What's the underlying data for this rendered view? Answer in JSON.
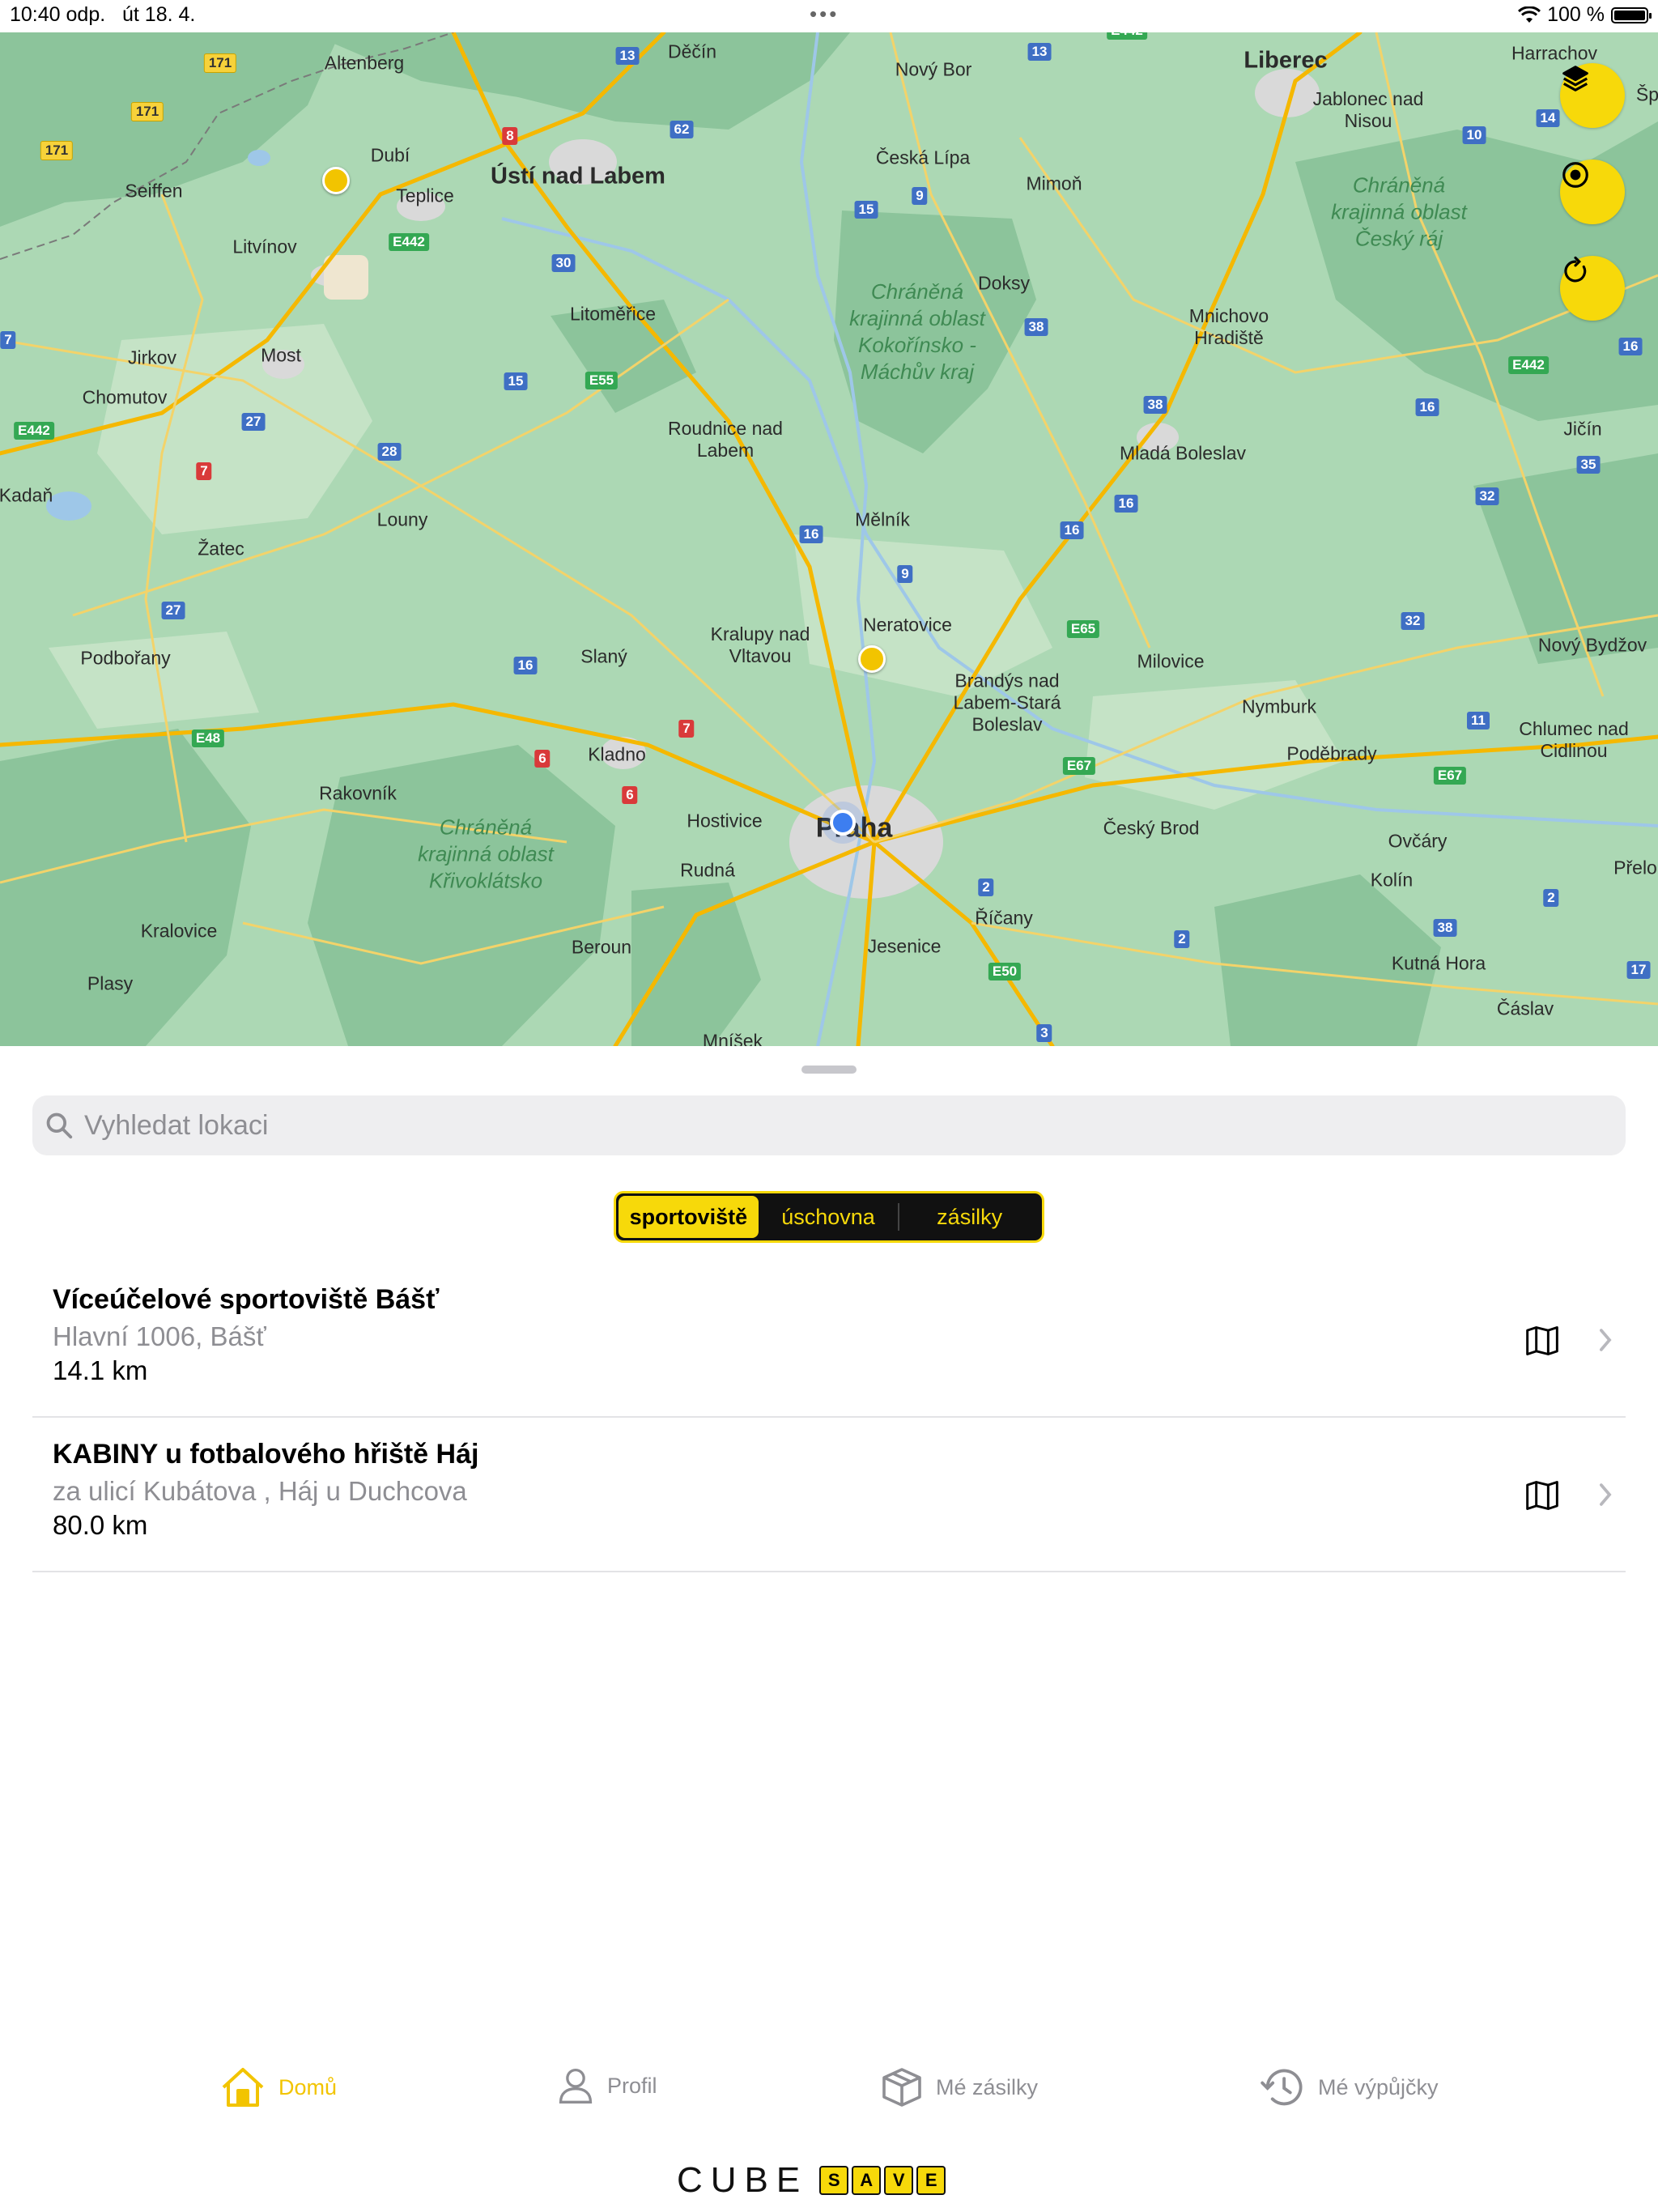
{
  "status_bar": {
    "time": "10:40 odp.",
    "date": "út 18. 4.",
    "battery_label": "100 %",
    "battery_level": 1.0
  },
  "map": {
    "labels": [
      {
        "text": "Altenberg",
        "size": "n"
      },
      {
        "text": "Děčín",
        "size": "n"
      },
      {
        "text": "Nový Bor",
        "size": "n"
      },
      {
        "text": "Liberec",
        "size": "big"
      },
      {
        "text": "Harrachov",
        "size": "n"
      },
      {
        "text": "Jablonec nad Nisou",
        "size": "n"
      },
      {
        "text": "Dubí",
        "size": "n"
      },
      {
        "text": "Ústí nad Labem",
        "size": "big"
      },
      {
        "text": "Teplice",
        "size": "n"
      },
      {
        "text": "Seiffen",
        "size": "n"
      },
      {
        "text": "Česká Lípa",
        "size": "n"
      },
      {
        "text": "Mimoň",
        "size": "n"
      },
      {
        "text": "Litvínov",
        "size": "n"
      },
      {
        "text": "Doksy",
        "size": "n"
      },
      {
        "text": "Litoměřice",
        "size": "n"
      },
      {
        "text": "Mnichovo Hradiště",
        "size": "n"
      },
      {
        "text": "Jirkov",
        "size": "n"
      },
      {
        "text": "Most",
        "size": "n"
      },
      {
        "text": "Chomutov",
        "size": "n"
      },
      {
        "text": "Roudnice nad Labem",
        "size": "n"
      },
      {
        "text": "Mladá Boleslav",
        "size": "n"
      },
      {
        "text": "Jičín",
        "size": "n"
      },
      {
        "text": "Kadaň",
        "size": "n"
      },
      {
        "text": "Louny",
        "size": "n"
      },
      {
        "text": "Mělník",
        "size": "n"
      },
      {
        "text": "Žatec",
        "size": "n"
      },
      {
        "text": "Neratovice",
        "size": "n"
      },
      {
        "text": "Kralupy nad Vltavou",
        "size": "n"
      },
      {
        "text": "Podbořany",
        "size": "n"
      },
      {
        "text": "Slaný",
        "size": "n"
      },
      {
        "text": "Brandýs nad Labem-Stará Boleslav",
        "size": "n"
      },
      {
        "text": "Milovice",
        "size": "n"
      },
      {
        "text": "Nový Bydžov",
        "size": "n"
      },
      {
        "text": "Nymburk",
        "size": "n"
      },
      {
        "text": "Chlumec nad Cidlinou",
        "size": "n"
      },
      {
        "text": "Kladno",
        "size": "n"
      },
      {
        "text": "Poděbrady",
        "size": "n"
      },
      {
        "text": "Rakovník",
        "size": "n"
      },
      {
        "text": "Hostivice",
        "size": "n"
      },
      {
        "text": "Praha",
        "size": "city"
      },
      {
        "text": "Český Brod",
        "size": "n"
      },
      {
        "text": "Ovčáry",
        "size": "n"
      },
      {
        "text": "Rudná",
        "size": "n"
      },
      {
        "text": "Kolín",
        "size": "n"
      },
      {
        "text": "Přelo",
        "size": "n"
      },
      {
        "text": "Říčany",
        "size": "n"
      },
      {
        "text": "Kralovice",
        "size": "n"
      },
      {
        "text": "Beroun",
        "size": "n"
      },
      {
        "text": "Jesenice",
        "size": "n"
      },
      {
        "text": "Kutná Hora",
        "size": "n"
      },
      {
        "text": "Plasy",
        "size": "n"
      },
      {
        "text": "Čáslav",
        "size": "n"
      },
      {
        "text": "Mníšek",
        "size": "n"
      },
      {
        "text": "Šp",
        "size": "n"
      }
    ],
    "protected_areas": [
      "Chráněná krajinná oblast Český ráj",
      "Chráněná krajinná oblast Kokořínsko - Máchův kraj",
      "Chráněná krajinná oblast Křivoklátsko"
    ],
    "road_shields": [
      {
        "text": "171",
        "kind": "yellow"
      },
      {
        "text": "171",
        "kind": "yellow"
      },
      {
        "text": "171",
        "kind": "yellow"
      },
      {
        "text": "13",
        "kind": "blue"
      },
      {
        "text": "13",
        "kind": "blue"
      },
      {
        "text": "E442",
        "kind": "green"
      },
      {
        "text": "62",
        "kind": "blue"
      },
      {
        "text": "8",
        "kind": "red"
      },
      {
        "text": "14",
        "kind": "blue"
      },
      {
        "text": "10",
        "kind": "blue"
      },
      {
        "text": "15",
        "kind": "blue"
      },
      {
        "text": "9",
        "kind": "blue"
      },
      {
        "text": "E442",
        "kind": "green"
      },
      {
        "text": "30",
        "kind": "blue"
      },
      {
        "text": "7",
        "kind": "blue"
      },
      {
        "text": "38",
        "kind": "blue"
      },
      {
        "text": "16",
        "kind": "blue"
      },
      {
        "text": "E55",
        "kind": "green"
      },
      {
        "text": "15",
        "kind": "blue"
      },
      {
        "text": "E442",
        "kind": "green"
      },
      {
        "text": "27",
        "kind": "blue"
      },
      {
        "text": "38",
        "kind": "blue"
      },
      {
        "text": "16",
        "kind": "blue"
      },
      {
        "text": "E442",
        "kind": "green"
      },
      {
        "text": "28",
        "kind": "blue"
      },
      {
        "text": "7",
        "kind": "red"
      },
      {
        "text": "35",
        "kind": "blue"
      },
      {
        "text": "32",
        "kind": "blue"
      },
      {
        "text": "16",
        "kind": "blue"
      },
      {
        "text": "16",
        "kind": "blue"
      },
      {
        "text": "16",
        "kind": "blue"
      },
      {
        "text": "9",
        "kind": "blue"
      },
      {
        "text": "27",
        "kind": "blue"
      },
      {
        "text": "E65",
        "kind": "green"
      },
      {
        "text": "32",
        "kind": "blue"
      },
      {
        "text": "16",
        "kind": "blue"
      },
      {
        "text": "11",
        "kind": "blue"
      },
      {
        "text": "7",
        "kind": "red"
      },
      {
        "text": "E48",
        "kind": "green"
      },
      {
        "text": "6",
        "kind": "red"
      },
      {
        "text": "E67",
        "kind": "green"
      },
      {
        "text": "E67",
        "kind": "green"
      },
      {
        "text": "6",
        "kind": "red"
      },
      {
        "text": "2",
        "kind": "blue"
      },
      {
        "text": "2",
        "kind": "blue"
      },
      {
        "text": "38",
        "kind": "blue"
      },
      {
        "text": "2",
        "kind": "blue"
      },
      {
        "text": "E50",
        "kind": "green"
      },
      {
        "text": "17",
        "kind": "blue"
      },
      {
        "text": "3",
        "kind": "blue"
      }
    ],
    "buttons": {
      "layers": "layers-icon",
      "locate": "locate-icon",
      "refresh": "refresh-icon"
    }
  },
  "search": {
    "placeholder": "Vyhledat lokaci"
  },
  "segments": {
    "sport": "sportoviště",
    "storage": "úschovna",
    "parcels": "zásilky",
    "selected": "sportoviště"
  },
  "locations": [
    {
      "title": "Víceúčelové sportoviště Bášť",
      "address": "Hlavní 1006, Bášť",
      "distance": "14.1 km"
    },
    {
      "title": "KABINY u fotbalového hřiště Háj",
      "address": "za ulicí Kubátova , Háj u Duchcova",
      "distance": "80.0 km"
    }
  ],
  "tabs": {
    "home": "Domů",
    "profile": "Profil",
    "parcels": "Mé zásilky",
    "rentals": "Mé výpůjčky",
    "active": "Domů"
  },
  "brand": {
    "word": "CUBE",
    "boxes": [
      "S",
      "A",
      "V",
      "E"
    ],
    "accent": "#f7d90a"
  }
}
